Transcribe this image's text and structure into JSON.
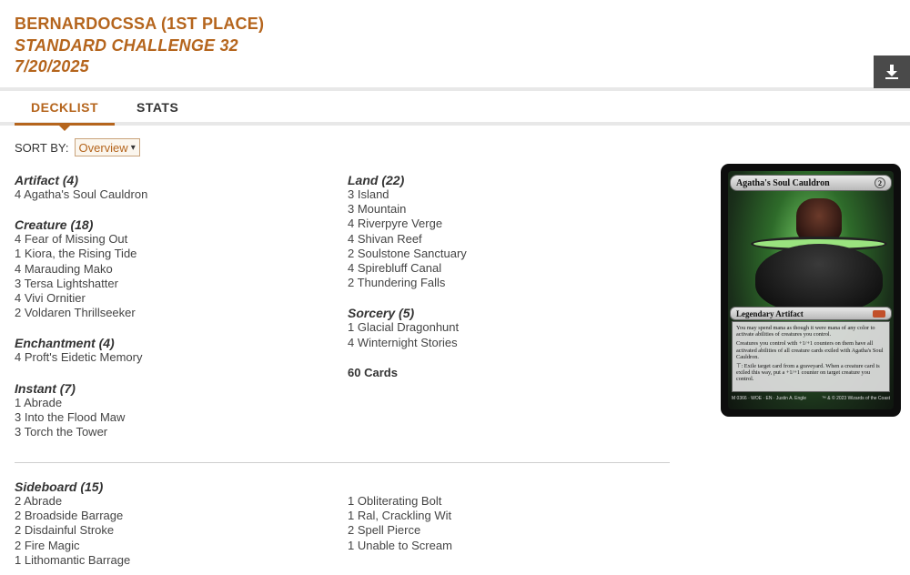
{
  "header": {
    "player": "BERNARDOCSSA (1ST PLACE)",
    "event": "STANDARD CHALLENGE 32",
    "date": "7/20/2025",
    "download_icon": "download-icon"
  },
  "tabs": [
    {
      "label": "DECKLIST",
      "active": true
    },
    {
      "label": "STATS",
      "active": false
    }
  ],
  "sort": {
    "label": "SORT BY:",
    "selected": "Overview"
  },
  "maindeck": {
    "left": [
      {
        "heading": "Artifact (4)",
        "cards": [
          "4 Agatha's Soul Cauldron"
        ]
      },
      {
        "heading": "Creature (18)",
        "cards": [
          "4 Fear of Missing Out",
          "1 Kiora, the Rising Tide",
          "4 Marauding Mako",
          "3 Tersa Lightshatter",
          "4 Vivi Ornitier",
          "2 Voldaren Thrillseeker"
        ]
      },
      {
        "heading": "Enchantment (4)",
        "cards": [
          "4 Proft's Eidetic Memory"
        ]
      },
      {
        "heading": "Instant (7)",
        "cards": [
          "1 Abrade",
          "3 Into the Flood Maw",
          "3 Torch the Tower"
        ]
      }
    ],
    "right": [
      {
        "heading": "Land (22)",
        "cards": [
          "3 Island",
          "3 Mountain",
          "4 Riverpyre Verge",
          "4 Shivan Reef",
          "2 Soulstone Sanctuary",
          "4 Spirebluff Canal",
          "2 Thundering Falls"
        ]
      },
      {
        "heading": "Sorcery (5)",
        "cards": [
          "1 Glacial Dragonhunt",
          "4 Winternight Stories"
        ]
      }
    ],
    "total": "60 Cards"
  },
  "sideboard": {
    "heading": "Sideboard (15)",
    "left": [
      "2 Abrade",
      "2 Broadside Barrage",
      "2 Disdainful Stroke",
      "2 Fire Magic",
      "1 Lithomantic Barrage"
    ],
    "right": [
      "1 Obliterating Bolt",
      "1 Ral, Crackling Wit",
      "2 Spell Pierce",
      "1 Unable to Scream"
    ]
  },
  "card_preview": {
    "name": "Agatha's Soul Cauldron",
    "cost": "2",
    "type": "Legendary Artifact",
    "rules": [
      "You may spend mana as though it were mana of any color to activate abilities of creatures you control.",
      "Creatures you control with +1/+1 counters on them have all activated abilities of all creature cards exiled with Agatha's Soul Cauldron.",
      "⊤: Exile target card from a graveyard. When a creature card is exiled this way, put a +1/+1 counter on target creature you control."
    ],
    "footer_left": "M 0366 · WOE · EN · Justin A. Engle",
    "footer_right": "™ & © 2023 Wizards of the Coast"
  },
  "colors": {
    "accent": "#b5651d",
    "button_dark": "#4a4a4a"
  }
}
